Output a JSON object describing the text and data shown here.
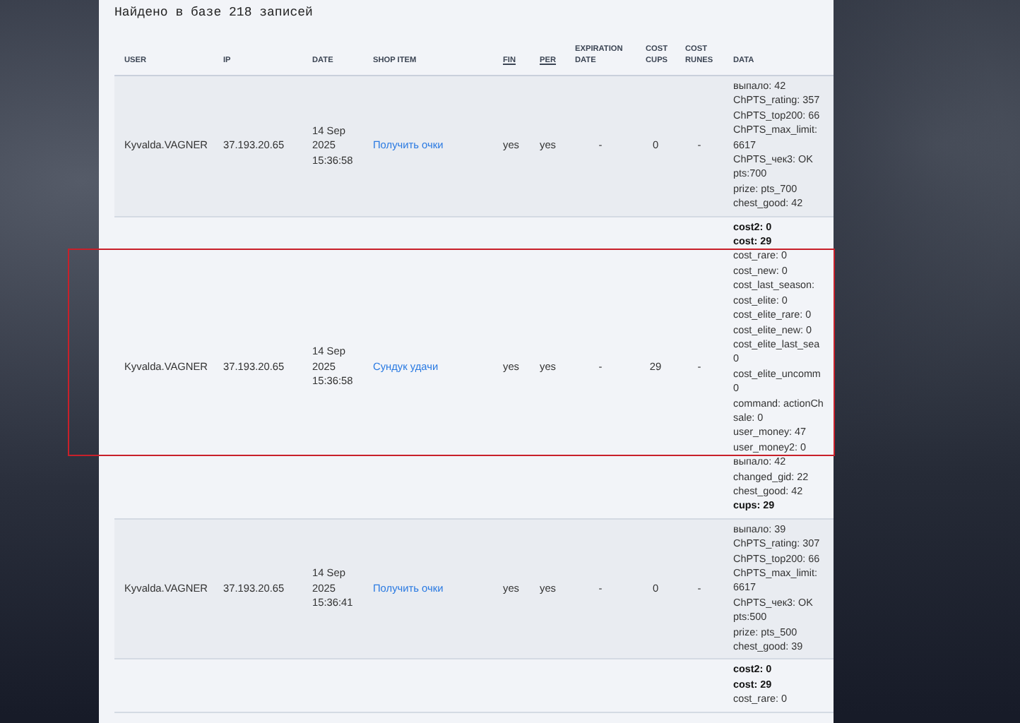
{
  "title": "Найдено в базе 218 записей",
  "columns": [
    {
      "label": "USER",
      "sortable": false
    },
    {
      "label": "IP",
      "sortable": false
    },
    {
      "label": "DATE",
      "sortable": false
    },
    {
      "label": "SHOP ITEM",
      "sortable": false
    },
    {
      "label": "FIN",
      "sortable": true
    },
    {
      "label": "PER",
      "sortable": true
    },
    {
      "label": "EXPIRATION DATE",
      "sortable": false
    },
    {
      "label": "COST CUPS",
      "sortable": false
    },
    {
      "label": "COST RUNES",
      "sortable": false
    },
    {
      "label": "DATA",
      "sortable": false
    }
  ],
  "rows": [
    {
      "user": "Kyvalda.VAGNER",
      "ip": "37.193.20.65",
      "date": "14 Sep 2025 15:36:58",
      "shop_item": "Получить очки",
      "fin": "yes",
      "per": "yes",
      "expiration": "-",
      "cost_cups": "0",
      "cost_runes": "-",
      "highlighted": false,
      "data": [
        {
          "text": "выпало: 42",
          "bold": false
        },
        {
          "text": "ChPTS_rating: 357",
          "bold": false
        },
        {
          "text": "ChPTS_top200: 66",
          "bold": false
        },
        {
          "text": "ChPTS_max_limit:",
          "bold": false
        },
        {
          "text": "6617",
          "bold": false
        },
        {
          "text": "ChPTS_чек3: OK",
          "bold": false
        },
        {
          "text": "pts:700",
          "bold": false
        },
        {
          "text": "prize: pts_700",
          "bold": false
        },
        {
          "text": "chest_good: 42",
          "bold": false
        }
      ]
    },
    {
      "user": "Kyvalda.VAGNER",
      "ip": "37.193.20.65",
      "date": "14 Sep 2025 15:36:58",
      "shop_item": "Сундук удачи",
      "fin": "yes",
      "per": "yes",
      "expiration": "-",
      "cost_cups": "29",
      "cost_runes": "-",
      "highlighted": true,
      "data": [
        {
          "text": "cost2: 0",
          "bold": true
        },
        {
          "text": "cost: 29",
          "bold": true
        },
        {
          "text": "cost_rare: 0",
          "bold": false
        },
        {
          "text": "cost_new: 0",
          "bold": false
        },
        {
          "text": "cost_last_season:",
          "bold": false
        },
        {
          "text": "cost_elite: 0",
          "bold": false
        },
        {
          "text": "cost_elite_rare: 0",
          "bold": false
        },
        {
          "text": "cost_elite_new: 0",
          "bold": false
        },
        {
          "text": "cost_elite_last_sea",
          "bold": false
        },
        {
          "text": "0",
          "bold": false
        },
        {
          "text": "cost_elite_uncomm",
          "bold": false
        },
        {
          "text": "0",
          "bold": false
        },
        {
          "text": "command: actionCh",
          "bold": false
        },
        {
          "text": "sale: 0",
          "bold": false
        },
        {
          "text": "user_money: 47",
          "bold": false
        },
        {
          "text": "user_money2: 0",
          "bold": false
        },
        {
          "text": "выпало: 42",
          "bold": false
        },
        {
          "text": "changed_gid: 22",
          "bold": false
        },
        {
          "text": "chest_good: 42",
          "bold": false
        },
        {
          "text": "cups: 29",
          "bold": true
        }
      ]
    },
    {
      "user": "Kyvalda.VAGNER",
      "ip": "37.193.20.65",
      "date": "14 Sep 2025 15:36:41",
      "shop_item": "Получить очки",
      "fin": "yes",
      "per": "yes",
      "expiration": "-",
      "cost_cups": "0",
      "cost_runes": "-",
      "highlighted": false,
      "data": [
        {
          "text": "выпало: 39",
          "bold": false
        },
        {
          "text": "ChPTS_rating: 307",
          "bold": false
        },
        {
          "text": "ChPTS_top200: 66",
          "bold": false
        },
        {
          "text": "ChPTS_max_limit:",
          "bold": false
        },
        {
          "text": "6617",
          "bold": false
        },
        {
          "text": "ChPTS_чек3: OK",
          "bold": false
        },
        {
          "text": "pts:500",
          "bold": false
        },
        {
          "text": "prize: pts_500",
          "bold": false
        },
        {
          "text": "chest_good: 39",
          "bold": false
        }
      ]
    },
    {
      "highlighted": false,
      "data": [
        {
          "text": "cost2: 0",
          "bold": true
        },
        {
          "text": "cost: 29",
          "bold": true
        },
        {
          "text": "cost_rare: 0",
          "bold": false
        }
      ]
    }
  ]
}
